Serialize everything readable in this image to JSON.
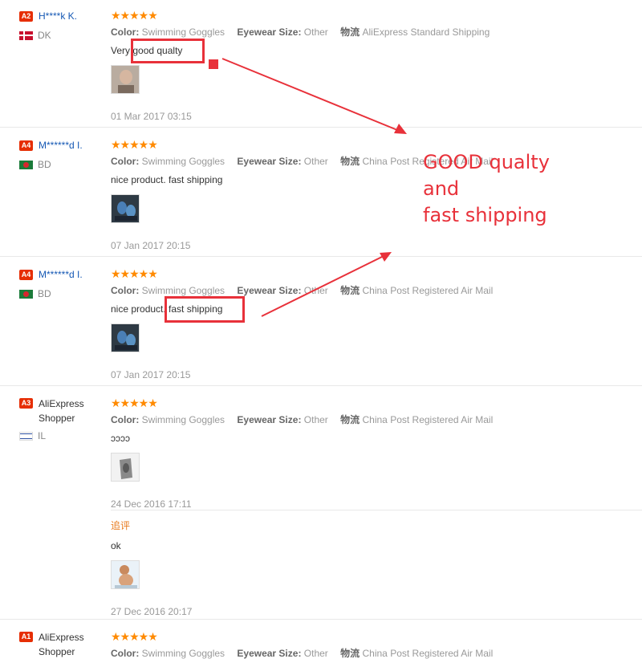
{
  "reviews": [
    {
      "level": "A2",
      "name": "H****k K.",
      "country": "DK",
      "flag": "dk",
      "stars": "★★★★★",
      "color_label": "Color:",
      "color_value": "Swimming Goggles",
      "size_label": "Eyewear Size:",
      "size_value": "Other",
      "ship_label": "物流",
      "ship_value": "AliExpress Standard Shipping",
      "text": "Very good qualty",
      "date": "01 Mar 2017 03:15"
    },
    {
      "level": "A4",
      "name": "M******d I.",
      "country": "BD",
      "flag": "bd",
      "stars": "★★★★★",
      "color_label": "Color:",
      "color_value": "Swimming Goggles",
      "size_label": "Eyewear Size:",
      "size_value": "Other",
      "ship_label": "物流",
      "ship_value": "China Post Registered Air Mail",
      "text": "nice product. fast shipping",
      "date": "07 Jan 2017 20:15"
    },
    {
      "level": "A4",
      "name": "M******d I.",
      "country": "BD",
      "flag": "bd",
      "stars": "★★★★★",
      "color_label": "Color:",
      "color_value": "Swimming Goggles",
      "size_label": "Eyewear Size:",
      "size_value": "Other",
      "ship_label": "物流",
      "ship_value": "China Post Registered Air Mail",
      "text": "nice product. fast shipping",
      "date": "07 Jan 2017 20:15"
    },
    {
      "level": "A3",
      "name": "AliExpress Shopper",
      "country": "IL",
      "flag": "il",
      "stars": "★★★★★",
      "color_label": "Color:",
      "color_value": "Swimming Goggles",
      "size_label": "Eyewear Size:",
      "size_value": "Other",
      "ship_label": "物流",
      "ship_value": "China Post Registered Air Mail",
      "text": "ɔɔɔɔ",
      "date": "24 Dec 2016 17:11",
      "followup": {
        "label": "追评",
        "text": "ok",
        "date": "27 Dec 2016 20:17"
      }
    },
    {
      "level": "A1",
      "name": "AliExpress Shopper",
      "stars": "★★★★★",
      "color_label": "Color:",
      "color_value": "Swimming Goggles",
      "size_label": "Eyewear Size:",
      "size_value": "Other",
      "ship_label": "物流",
      "ship_value": "China Post Registered Air Mail"
    }
  ],
  "annotation": {
    "line1": "GOOD qualty",
    "line2": "and",
    "line3": "fast shipping",
    "color": "#e8313a"
  },
  "colors": {
    "star": "#ff8a00",
    "link": "#1558b4",
    "level_badge": "#e62e04",
    "followup": "#e87b1e"
  }
}
